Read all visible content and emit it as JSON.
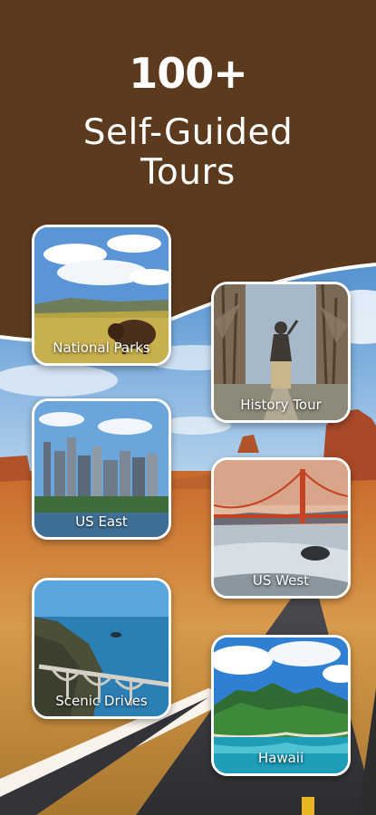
{
  "hero": {
    "count": "100+",
    "line1": "Self-Guided",
    "line2": "Tours"
  },
  "colors": {
    "header_brown": "#5c3a1e",
    "sky_blue": "#6fa6d8",
    "desert_orange": "#c9722f",
    "road_gray": "#3b3b3f",
    "card_border": "#ffffff"
  },
  "tours": [
    {
      "label": "National Parks",
      "image": "bison-prairie"
    },
    {
      "label": "History Tour",
      "image": "statue-park"
    },
    {
      "label": "US East",
      "image": "city-skyline"
    },
    {
      "label": "US West",
      "image": "golden-gate-bridge"
    },
    {
      "label": "Scenic Drives",
      "image": "coastal-bridge"
    },
    {
      "label": "Hawaii",
      "image": "island-coast"
    }
  ]
}
